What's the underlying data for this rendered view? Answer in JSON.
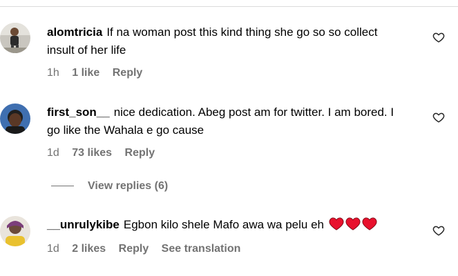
{
  "comments": [
    {
      "username": "alomtricia",
      "text": "If na woman post this kind thing she go so so collect insult of her life",
      "time": "1h",
      "likes": "1 like",
      "reply": "Reply"
    },
    {
      "username": "first_son__",
      "text": "nice dedication. Abeg post am for twitter. I am bored. I go like the Wahala e go cause",
      "time": "1d",
      "likes": "73 likes",
      "reply": "Reply",
      "view_replies": "View replies (6)"
    },
    {
      "username": "__unrulykibe",
      "text": "Egbon kilo shele Mafo awa wa pelu eh",
      "emoji": [
        "red-heart-icon",
        "red-heart-icon",
        "red-heart-icon"
      ],
      "time": "1d",
      "likes": "2 likes",
      "reply": "Reply",
      "translate": "See translation"
    }
  ],
  "colors": {
    "text": "#000000",
    "meta": "#737373",
    "divider": "#dbdbdb",
    "heart_emoji": "#e8112d"
  }
}
